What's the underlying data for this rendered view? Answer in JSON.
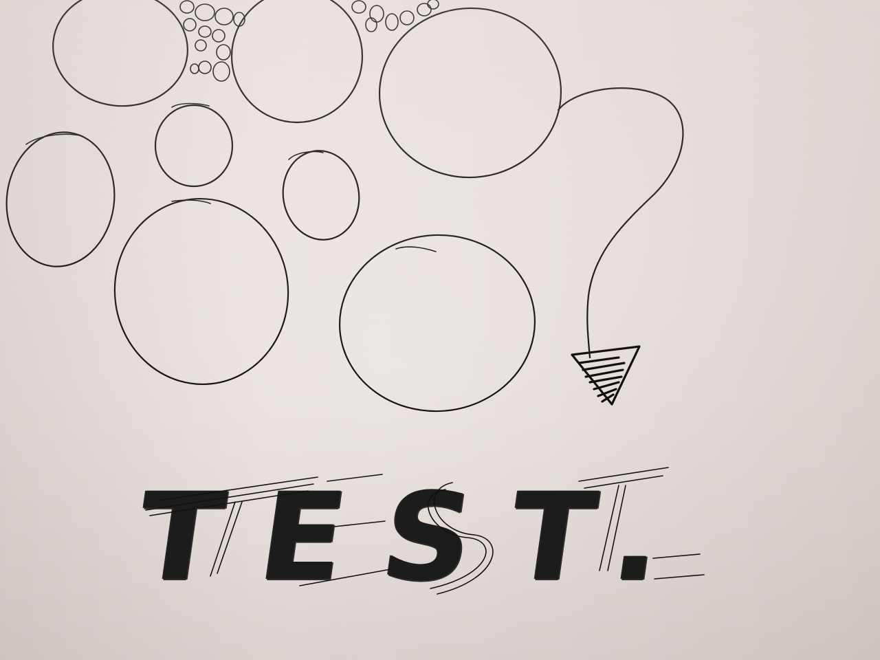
{
  "handwriting": {
    "text": "TEST."
  },
  "colors": {
    "paper": "#ebe3df",
    "ink": "#141212"
  }
}
